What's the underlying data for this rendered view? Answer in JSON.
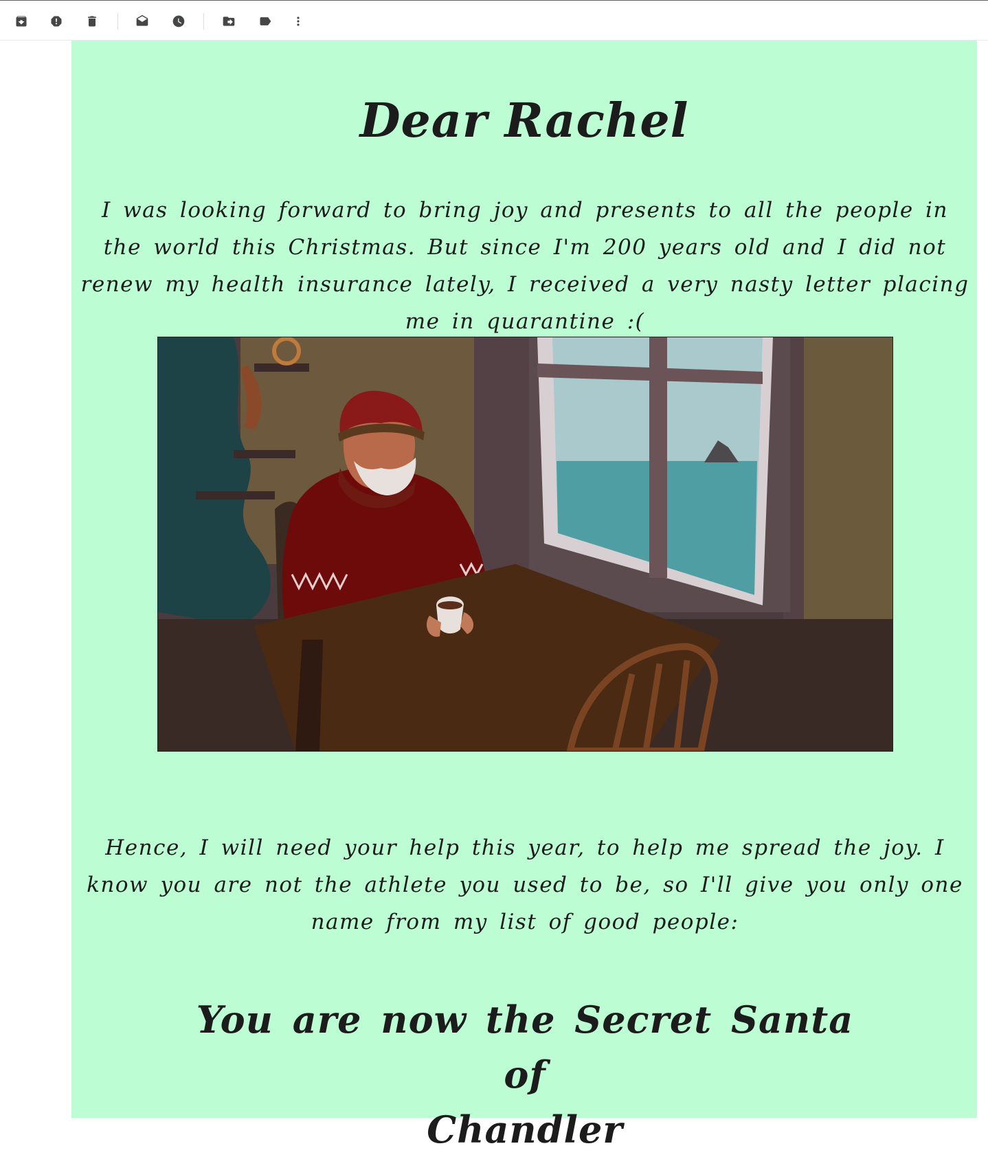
{
  "toolbar": {
    "buttons": [
      {
        "name": "archive",
        "icon": "archive-icon",
        "label": "Archive"
      },
      {
        "name": "report-spam",
        "icon": "report-spam-icon",
        "label": "Report spam"
      },
      {
        "name": "delete",
        "icon": "trash-icon",
        "label": "Delete"
      },
      {
        "name": "mark-unread",
        "icon": "mark-unread-icon",
        "label": "Mark as unread"
      },
      {
        "name": "snooze",
        "icon": "clock-icon",
        "label": "Snooze"
      },
      {
        "name": "move-to",
        "icon": "move-to-folder-icon",
        "label": "Move to"
      },
      {
        "name": "labels",
        "icon": "label-icon",
        "label": "Labels"
      },
      {
        "name": "more",
        "icon": "more-vert-icon",
        "label": "More"
      }
    ]
  },
  "email": {
    "background_color": "#bcfdd3",
    "title": "Dear Rachel",
    "paragraph_1": "I was looking forward to bring joy and presents to all the people in the world this Christmas. But since I'm 200 years old and I did not renew my health insurance lately, I received a very nasty letter placing me in quarantine :(",
    "paragraph_2": "Hence, I will need your help this year, to help me spread the joy. I know you are not the athlete you used to be, so I'll give you only one name from my list of good people:",
    "reveal_line_1": "You are now the Secret Santa of",
    "reveal_line_2": "Chandler"
  }
}
